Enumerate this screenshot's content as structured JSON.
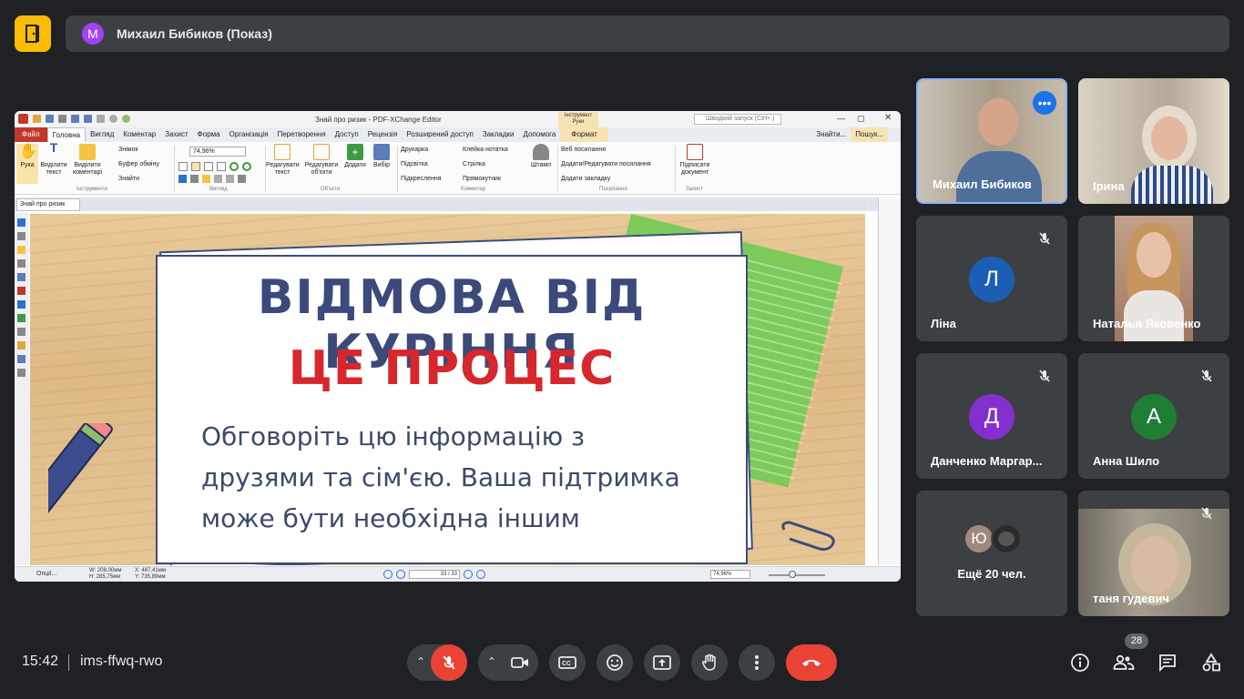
{
  "header": {
    "presenter_initial": "M",
    "presenter_label": "Михаил Бибиков (Показ)"
  },
  "app": {
    "window_title": "Знай про ризик - PDF-XChange Editor",
    "search_placeholder": "Швидкий запуск (Ctrl+.)",
    "tool_badge": "Інструмент Руки",
    "menus": [
      "Файл",
      "Головна",
      "Вигляд",
      "Коментар",
      "Захист",
      "Форма",
      "Організація",
      "Перетворення",
      "Доступ",
      "Рецензія",
      "Розширений доступ",
      "Закладки",
      "Допомога",
      "Формат"
    ],
    "search_tabs": [
      "Знайти...",
      "Пошук..."
    ],
    "ribbon": {
      "hand": "Рука",
      "select_text": "Виділити текст",
      "select_comments": "Виділити коментарі",
      "snapshot": "Знімок",
      "clipboard": "Буфер обміну",
      "find": "Знайти",
      "zoom_value": "74,96%",
      "edit_text": "Редагувати текст",
      "edit_objects": "Редагувати об'єкти",
      "add": "Додати",
      "select": "Вибір",
      "typewriter": "Друкарка",
      "highlight": "Підсвітка",
      "underline": "Підкреслення",
      "sticky_note": "Клейка нотатка",
      "arrow": "Стрілка",
      "rectangle": "Прямокутник",
      "stamp": "Штамп",
      "web_links": "Веб посилання",
      "add_edit_links": "Додати/Редагувати посилання",
      "add_bookmark": "Додати закладку",
      "sign_doc": "Підписати документ",
      "groups": [
        "Інструменти",
        "Вигляд",
        "Об'єкти",
        "Коментар",
        "Посилання",
        "Захист"
      ]
    },
    "doc_tab": "Знай про ризик",
    "status": {
      "options": "Опції...",
      "width": "W: 208,00мм",
      "height": "H: 285,75мм",
      "x": "X: 487,41мм",
      "y": "Y: 735,89мм",
      "page": "33 / 33",
      "zoom": "74,96%"
    }
  },
  "slide": {
    "title": "ВІДМОВА ВІД КУРІННЯ",
    "subtitle": "ЦЕ ПРОЦЕС",
    "body_lines": [
      "Обговоріть цю інформацію з",
      "друзями та сім'єю. Ваша підтримка",
      "може бути необхідна іншим"
    ]
  },
  "participants": [
    {
      "name": "Михаил Бибиков",
      "type": "video",
      "bg": "#8b7d6b"
    },
    {
      "name": "Ірина",
      "type": "video",
      "bg": "#b8a998"
    },
    {
      "name": "Ліна",
      "type": "avatar",
      "initial": "Л",
      "color": "#1a5fb4",
      "muted": true
    },
    {
      "name": "Наталья Яковенко",
      "type": "video",
      "bg": "#c9b2a0",
      "muted": false
    },
    {
      "name": "Данченко Маргар...",
      "type": "avatar",
      "initial": "Д",
      "color": "#8430ce",
      "muted": true
    },
    {
      "name": "Анна Шило",
      "type": "avatar",
      "initial": "А",
      "color": "#1e7e34",
      "muted": true
    },
    {
      "name": "Ещё 20 чел.",
      "type": "more",
      "initial": "Ю"
    },
    {
      "name": "таня гудевич",
      "type": "video",
      "bg": "#8c8a7f",
      "muted": true
    }
  ],
  "footer": {
    "time": "15:42",
    "meeting_code": "ims-ffwq-rwo",
    "participant_count": "28"
  },
  "colors": {
    "meet_bg": "#202124",
    "tile_bg": "#3c4043",
    "end_call": "#ea4335",
    "mic_off": "#ea4335",
    "logo": "#fbbc04"
  }
}
